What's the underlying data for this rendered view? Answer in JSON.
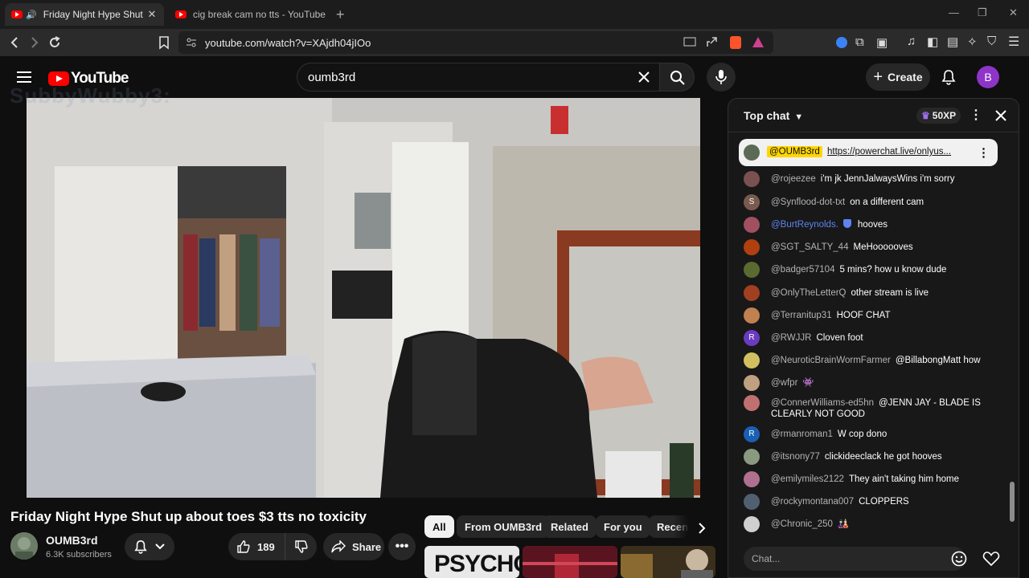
{
  "browser": {
    "tabs": [
      {
        "title": "Friday Night Hype Shut up ab",
        "active": true
      },
      {
        "title": "cig break cam no tts - YouTube",
        "active": false
      }
    ],
    "url": "youtube.com/watch?v=XAjdh04jIOo"
  },
  "header": {
    "logo_text": "YouTube",
    "search_value": "oumb3rd",
    "create_label": "Create",
    "avatar_letter": "B"
  },
  "video": {
    "overlay_text": "SubbyWubby3:",
    "title": "Friday Night Hype Shut up about toes $3 tts no toxicity",
    "channel": "OUMB3rd",
    "subscribers": "6.3K subscribers",
    "likes": "189",
    "share_label": "Share"
  },
  "chips": [
    "All",
    "From OUMB3rd",
    "Related",
    "For you",
    "Recen"
  ],
  "thumbnails": [
    {
      "text": "PSYCHO",
      "bg": "#e8e8e8"
    },
    {
      "text": "",
      "bg": "#7a1e2c"
    },
    {
      "text": "",
      "bg": "#4a3a22"
    }
  ],
  "chat": {
    "mode_label": "Top chat",
    "xp_label": "50XP",
    "pinned": {
      "user": "@OUMB3rd",
      "link": "https://powerchat.live/onlyus..."
    },
    "messages": [
      {
        "user": "@rojeezee",
        "text": "i'm jk JennJalwaysWins i'm sorry",
        "avatar_color": "#7a5050",
        "letter": "",
        "mod": false
      },
      {
        "user": "@Synflood-dot-txt",
        "text": "on a different cam",
        "avatar_color": "#7a5a4f",
        "letter": "S",
        "mod": false
      },
      {
        "user": "@BurtReynolds.",
        "text": "hooves",
        "avatar_color": "#a05060",
        "letter": "",
        "mod": true
      },
      {
        "user": "@SGT_SALTY_44",
        "text": "MeHoooooves",
        "avatar_color": "#b04010",
        "letter": "",
        "mod": false
      },
      {
        "user": "@badger57104",
        "text": "5 mins? how u know dude",
        "avatar_color": "#5a6a30",
        "letter": "",
        "mod": false
      },
      {
        "user": "@OnlyTheLetterQ",
        "text": "other stream is live",
        "avatar_color": "#a04020",
        "letter": "",
        "mod": false
      },
      {
        "user": "@Terranitup31",
        "text": "HOOF CHAT",
        "avatar_color": "#c08050",
        "letter": "",
        "mod": false
      },
      {
        "user": "@RWJJR",
        "text": "Cloven foot",
        "avatar_color": "#6a3ac0",
        "letter": "R",
        "mod": false
      },
      {
        "user": "@NeuroticBrainWormFarmer",
        "text": "@BillabongMatt how",
        "avatar_color": "#d0c060",
        "letter": "",
        "mod": false
      },
      {
        "user": "@wfpr",
        "text": "👾",
        "avatar_color": "#c0a080",
        "letter": "",
        "mod": false
      },
      {
        "user": "@ConnerWilliams-ed5hn",
        "text": "@JENN JAY - BLADE IS CLEARLY NOT GOOD",
        "avatar_color": "#c07070",
        "letter": "",
        "mod": false
      },
      {
        "user": "@rmanroman1",
        "text": "W cop dono",
        "avatar_color": "#1a5fb4",
        "letter": "R",
        "mod": false
      },
      {
        "user": "@itsnony77",
        "text": "clickideeclack he got hooves",
        "avatar_color": "#8a9a80",
        "letter": "",
        "mod": false
      },
      {
        "user": "@emilymiles2122",
        "text": "They ain't taking him home",
        "avatar_color": "#b07090",
        "letter": "",
        "mod": false
      },
      {
        "user": "@rockymontana007",
        "text": "CLOPPERS",
        "avatar_color": "#506070",
        "letter": "",
        "mod": false
      },
      {
        "user": "@Chronic_250",
        "text": "🎎",
        "avatar_color": "#d0d0d0",
        "letter": "",
        "mod": false
      }
    ],
    "input_placeholder": "Chat..."
  },
  "colors": {
    "yt_red": "#ff0000",
    "mod_blue": "#5e84f1",
    "pinned_highlight": "#ffd600"
  }
}
